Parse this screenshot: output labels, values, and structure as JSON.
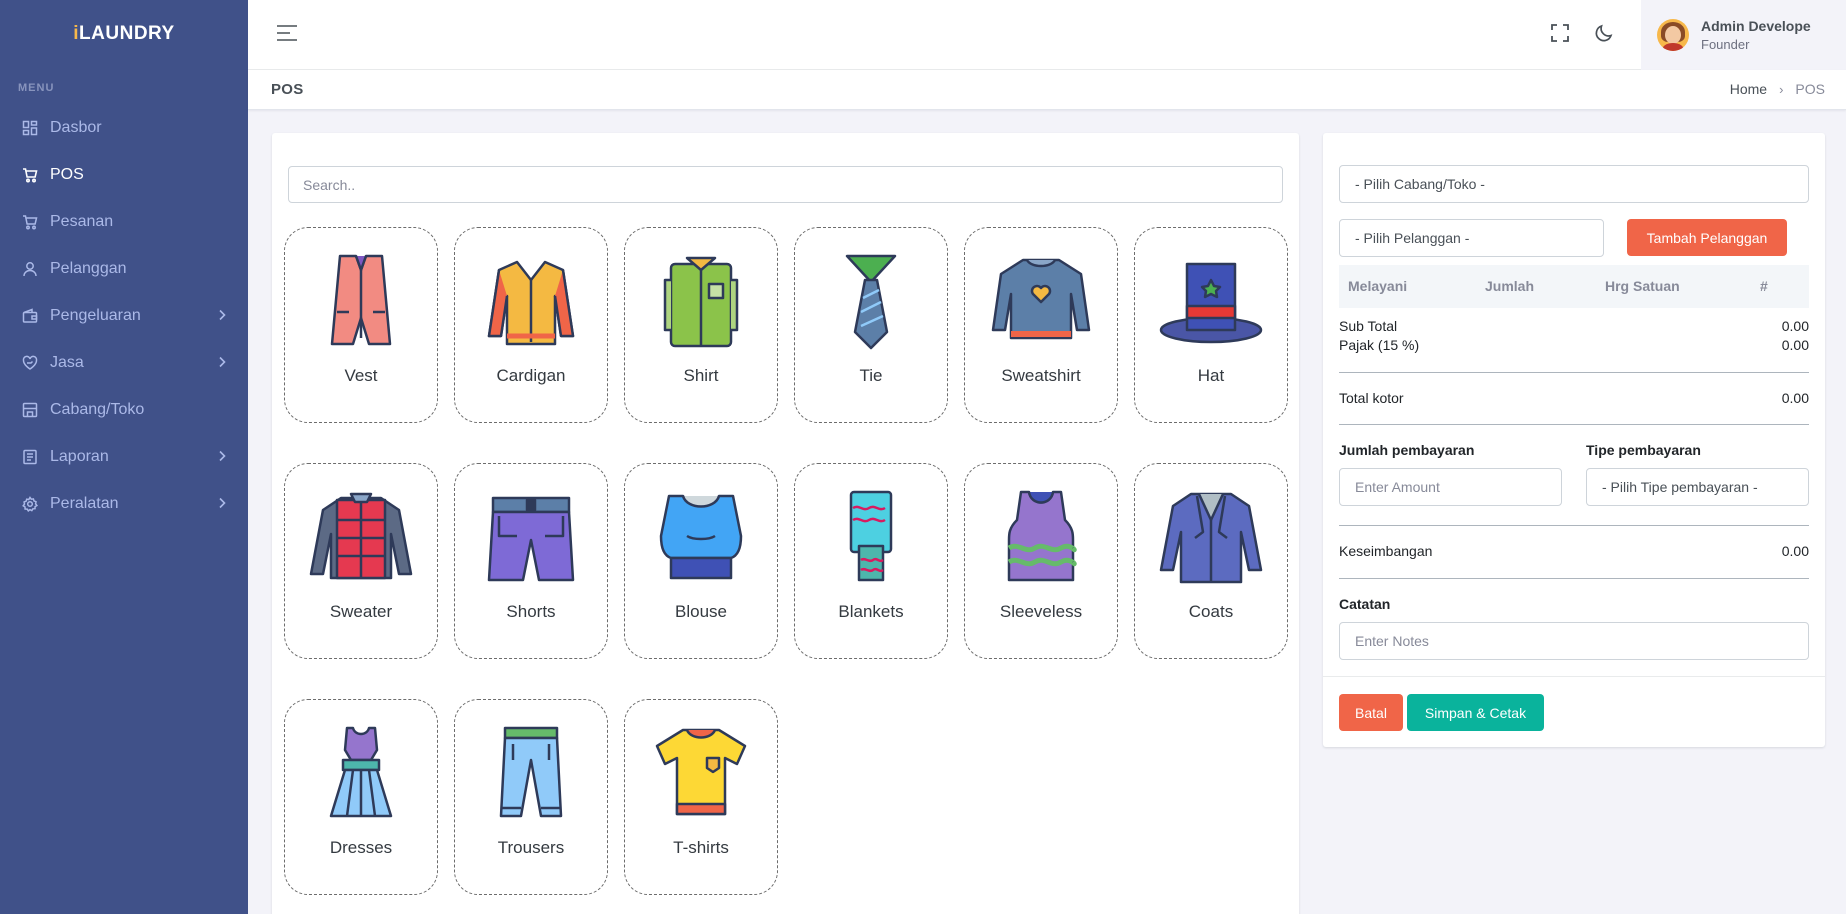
{
  "sidebar": {
    "logo_prefix": "i",
    "logo_rest": "LAUNDRY",
    "menu_title": "MENU",
    "items": [
      {
        "label": "Dasbor",
        "icon": "dashboard-icon",
        "active": false,
        "has_children": false
      },
      {
        "label": "POS",
        "icon": "cart-icon",
        "active": true,
        "has_children": false
      },
      {
        "label": "Pesanan",
        "icon": "cart-icon",
        "active": false,
        "has_children": false
      },
      {
        "label": "Pelanggan",
        "icon": "user-icon",
        "active": false,
        "has_children": false
      },
      {
        "label": "Pengeluaran",
        "icon": "wallet-icon",
        "active": false,
        "has_children": true
      },
      {
        "label": "Jasa",
        "icon": "hand-heart-icon",
        "active": false,
        "has_children": true
      },
      {
        "label": "Cabang/Toko",
        "icon": "store-icon",
        "active": false,
        "has_children": false
      },
      {
        "label": "Laporan",
        "icon": "report-icon",
        "active": false,
        "has_children": true
      },
      {
        "label": "Peralatan",
        "icon": "gear-icon",
        "active": false,
        "has_children": true
      }
    ]
  },
  "topbar": {
    "user_name": "Admin Develope",
    "user_role": "Founder"
  },
  "page": {
    "title": "POS",
    "breadcrumb_home": "Home",
    "breadcrumb_current": "POS"
  },
  "products": {
    "search_placeholder": "Search..",
    "items": [
      "Vest",
      "Cardigan",
      "Shirt",
      "Tie",
      "Sweatshirt",
      "Hat",
      "Sweater",
      "Shorts",
      "Blouse",
      "Blankets",
      "Sleeveless",
      "Coats",
      "Dresses",
      "Trousers",
      "T-shirts"
    ]
  },
  "order": {
    "branch_select": "- Pilih Cabang/Toko -",
    "customer_select": "- Pilih Pelanggan -",
    "add_customer_label": "Tambah Pelanggan",
    "columns": [
      "Melayani",
      "Jumlah",
      "Hrg Satuan",
      "#"
    ],
    "subtotal_label": "Sub Total",
    "subtotal_value": "0.00",
    "tax_label": "Pajak (15 %)",
    "tax_value": "0.00",
    "gross_label": "Total kotor",
    "gross_value": "0.00",
    "amount_label": "Jumlah pembayaran",
    "amount_placeholder": "Enter Amount",
    "payment_type_label": "Tipe pembayaran",
    "payment_type_select": "- Pilih Tipe pembayaran -",
    "balance_label": "Keseimbangan",
    "balance_value": "0.00",
    "notes_label": "Catatan",
    "notes_placeholder": "Enter Notes",
    "cancel_label": "Batal",
    "save_label": "Simpan & Cetak"
  },
  "colors": {
    "sidebar": "#405189",
    "accent_danger": "#f06548",
    "accent_success": "#0ab39c",
    "logo_accent": "#f7b84b"
  }
}
